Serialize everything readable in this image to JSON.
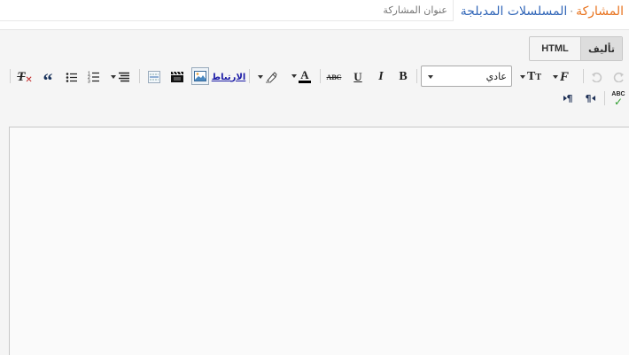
{
  "header": {
    "blog_name": "المسلسلات المدبلجة",
    "separator": "·",
    "post_label": "المشاركة",
    "title_placeholder": "عنوان المشاركة"
  },
  "mode_tabs": {
    "compose": "تأليف",
    "html": "HTML"
  },
  "toolbar": {
    "font_value": "عادي",
    "link_label": "الارتباط"
  },
  "icons": [
    "undo-icon",
    "redo-icon",
    "font-family-icon",
    "font-size-icon",
    "bold-icon",
    "italic-icon",
    "underline-icon",
    "strikethrough-icon",
    "text-color-icon",
    "highlight-icon",
    "link-icon",
    "image-icon",
    "video-icon",
    "jump-break-icon",
    "align-icon",
    "numbered-list-icon",
    "bulleted-list-icon",
    "quote-icon",
    "clear-format-icon",
    "spellcheck-icon",
    "rtl-icon",
    "ltr-icon"
  ],
  "colors": {
    "blog_name": "#3166b8",
    "post_label": "#e8731e",
    "link": "#1a1aa6"
  }
}
